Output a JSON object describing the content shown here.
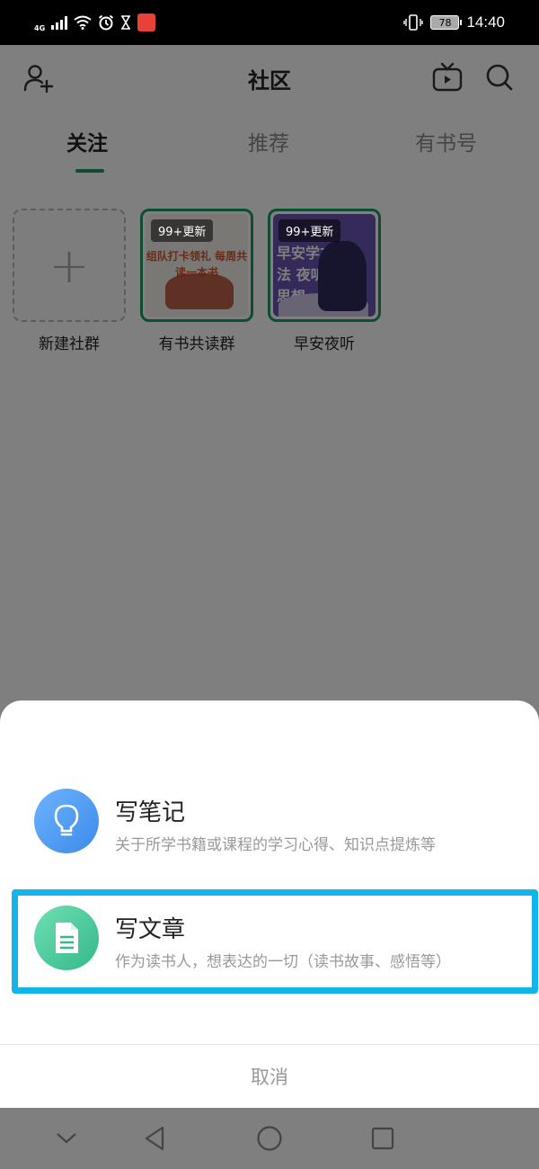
{
  "status_bar": {
    "network": "4G",
    "battery": "78",
    "time": "14:40"
  },
  "header": {
    "title": "社区"
  },
  "tabs": [
    {
      "label": "关注",
      "active": true
    },
    {
      "label": "推荐",
      "active": false
    },
    {
      "label": "有书号",
      "active": false
    }
  ],
  "groups": [
    {
      "name": "新建社群"
    },
    {
      "name": "有书共读群",
      "badge": "99+更新",
      "cover_text": "组队打卡领礼 每周共读一本书"
    },
    {
      "name": "早安夜听",
      "badge": "99+更新",
      "cover_text": "早安学方法 夜听提思想"
    }
  ],
  "sheet": {
    "actions": [
      {
        "title": "写笔记",
        "subtitle": "关于所学书籍或课程的学习心得、知识点提炼等",
        "icon": "lightbulb-icon"
      },
      {
        "title": "写文章",
        "subtitle": "作为读书人，想表达的一切（读书故事、感悟等）",
        "icon": "document-icon"
      }
    ],
    "cancel": "取消"
  },
  "colors": {
    "accent": "#1c9a62",
    "highlight": "#13b4e8"
  }
}
